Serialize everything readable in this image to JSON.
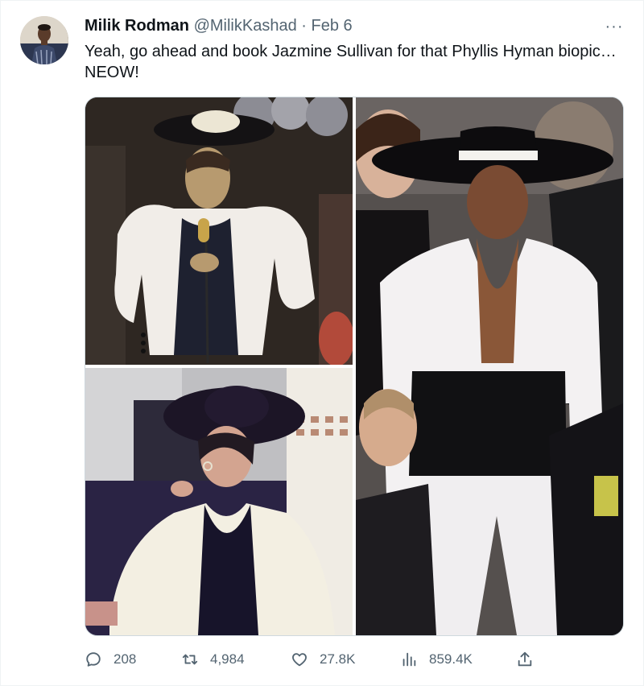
{
  "tweet": {
    "author_name": "Milik Rodman",
    "handle": "@MilikKashad",
    "separator": "·",
    "date": "Feb 6",
    "more_label": "···",
    "text": "Yeah, go ahead and book Jazmine Sullivan for that Phyllis Hyman biopic… NEOW!"
  },
  "actions": {
    "replies": "208",
    "retweets": "4,984",
    "likes": "27.8K",
    "views": "859.4K"
  },
  "icons": {
    "reply": "reply-icon",
    "retweet": "retweet-icon",
    "like": "heart-icon",
    "views": "views-icon",
    "share": "share-icon",
    "more": "more-icon"
  },
  "colors": {
    "text": "#0f1419",
    "secondary": "#536471",
    "border": "#cfd9de"
  }
}
